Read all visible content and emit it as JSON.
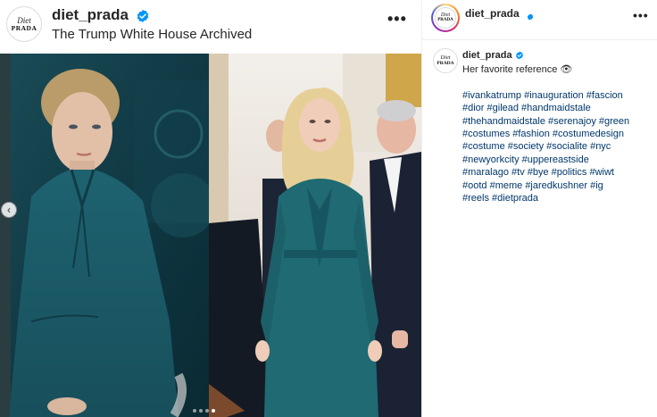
{
  "post": {
    "username": "diet_prada",
    "subtitle": "The Trump White House Archived",
    "avatar": {
      "line1": "Diet",
      "line2": "PRADA"
    },
    "more_label": "•••",
    "carousel": {
      "count": 4,
      "active_index": 3
    }
  },
  "sidebar": {
    "username": "diet_prada",
    "more_label": "•••"
  },
  "caption": {
    "username": "diet_prada",
    "text": "Her favorite reference 👁",
    "hashtag_lines": [
      "#ivankatrump #inauguration #fascion",
      "#dior #gilead #handmaidstale",
      "#thehandmaidstale #serenajoy #green",
      "#costumes #fashion #costumedesign",
      "#costume #society #socialite #nyc",
      "#newyorkcity #uppereastside",
      "#maralago #tv #bye #politics #wiwt",
      "#ootd #meme #jaredkushner #ig",
      "#reels #dietprada"
    ]
  },
  "colors": {
    "verified": "#0095f6",
    "hashtag": "#00376b",
    "teal_dress": "#1f6a73"
  }
}
